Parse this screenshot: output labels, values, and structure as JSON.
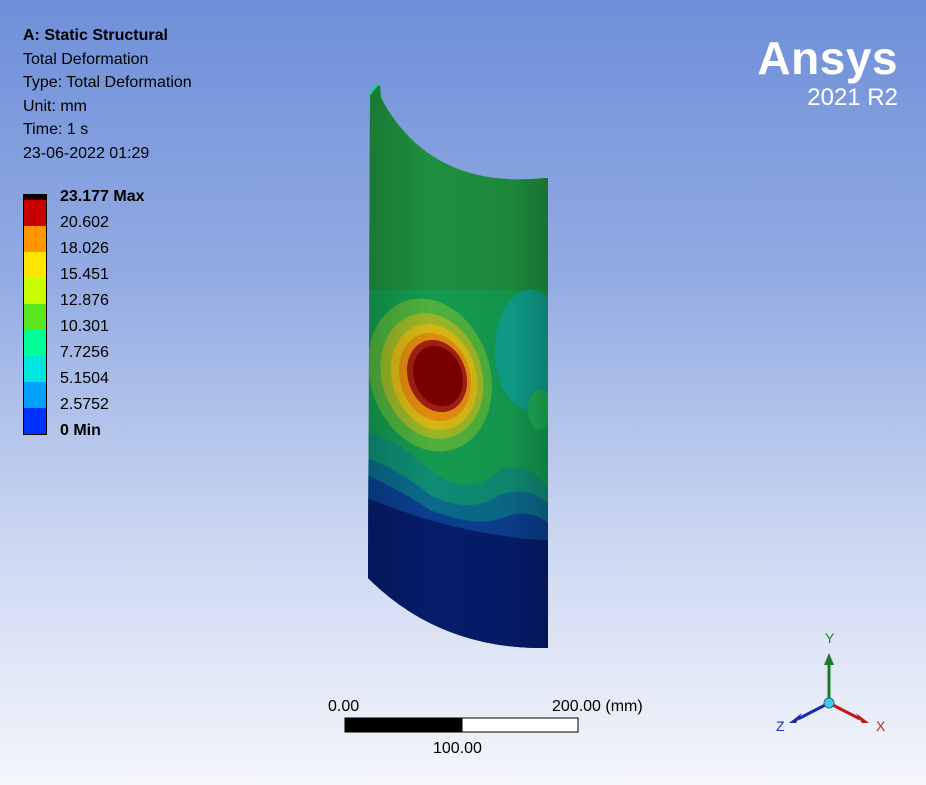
{
  "info": {
    "title": "A: Static Structural",
    "result": "Total Deformation",
    "type": "Type: Total Deformation",
    "unit": "Unit: mm",
    "time": "Time: 1 s",
    "date": "23-06-2022 01:29"
  },
  "brand": {
    "name": "Ansys",
    "version": "2021 R2"
  },
  "legend": {
    "levels": [
      {
        "label": "23.177 Max",
        "color": "#c80000"
      },
      {
        "label": "20.602",
        "color": "#ff9600"
      },
      {
        "label": "18.026",
        "color": "#ffe600"
      },
      {
        "label": "15.451",
        "color": "#c8ff00"
      },
      {
        "label": "12.876",
        "color": "#5ae61e"
      },
      {
        "label": "10.301",
        "color": "#00ff96"
      },
      {
        "label": "7.7256",
        "color": "#00e6dc"
      },
      {
        "label": "5.1504",
        "color": "#00a0ff"
      },
      {
        "label": "2.5752",
        "color": "#0032ff"
      },
      {
        "label": "0 Min",
        "color": ""
      }
    ]
  },
  "scale_bar": {
    "start": "0.00",
    "end": "200.00 (mm)",
    "middle": "100.00"
  },
  "triad": {
    "x": "X",
    "y": "Y",
    "z": "Z"
  }
}
